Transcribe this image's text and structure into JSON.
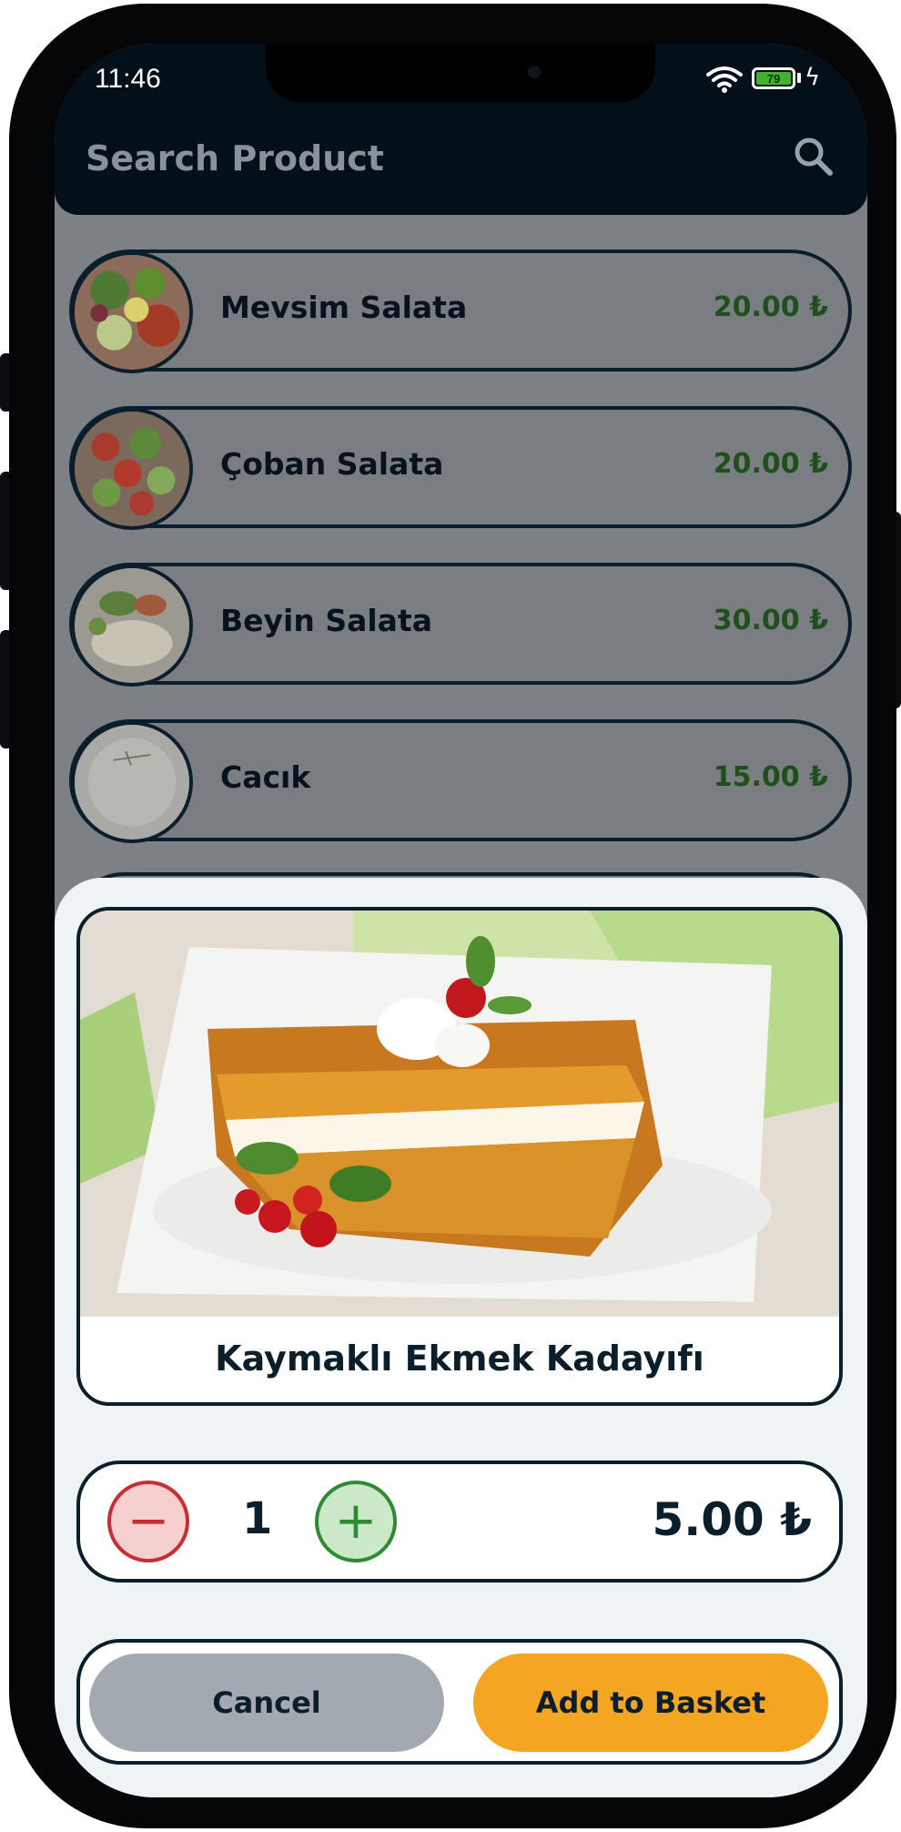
{
  "status_bar": {
    "time": "11:46",
    "battery": "79",
    "battery_level": 0.79
  },
  "search": {
    "placeholder": "Search Product"
  },
  "products": [
    {
      "name": "Mevsim Salata",
      "price": "20.00 ₺"
    },
    {
      "name": "Çoban Salata",
      "price": "20.00 ₺"
    },
    {
      "name": "Beyin Salata",
      "price": "30.00 ₺"
    },
    {
      "name": "Cacık",
      "price": "15.00 ₺"
    }
  ],
  "detail": {
    "title": "Kaymaklı Ekmek Kadayıfı",
    "quantity": "1",
    "minus": "−",
    "plus": "+",
    "price": "5.00 ₺",
    "cancel_label": "Cancel",
    "add_label": "Add to Basket"
  },
  "colors": {
    "header": "#031019",
    "accent": "#f4a623",
    "price_green": "#1f4f1a",
    "minus_red": "#c72d31",
    "plus_green": "#2e8b34"
  }
}
